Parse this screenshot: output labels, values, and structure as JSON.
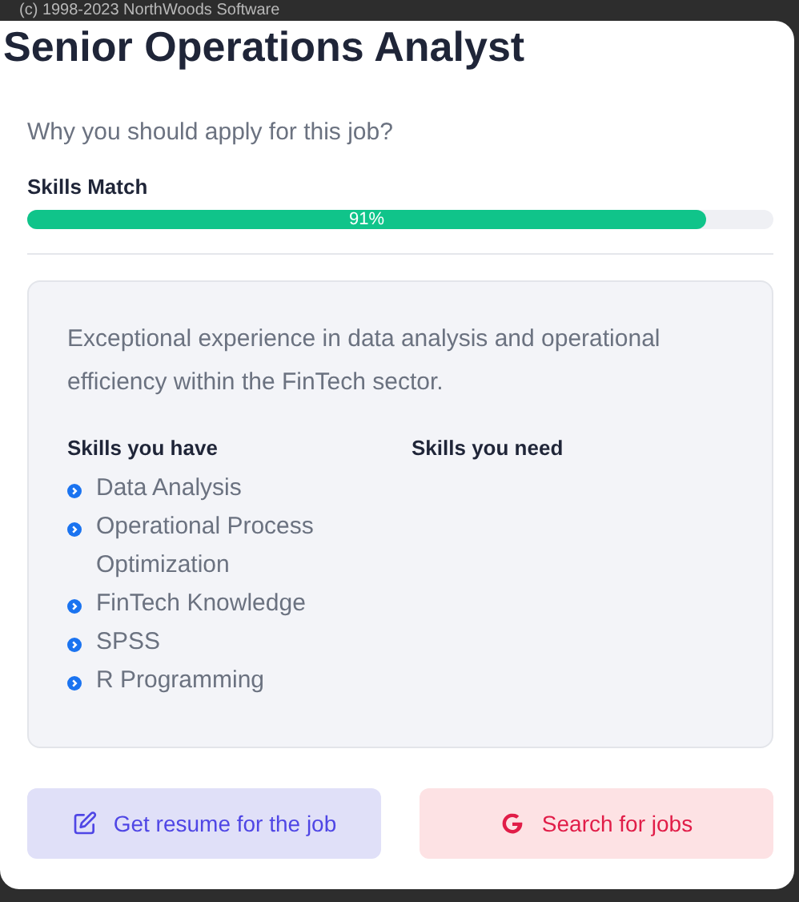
{
  "backdrop": {
    "copyright": "(c) 1998-2023 NorthWoods Software"
  },
  "dialog": {
    "title": "Senior Operations Analyst",
    "subtitle": "Why you should apply for this job?",
    "skills_match": {
      "label": "Skills Match",
      "level": 0.91,
      "reading": "91%"
    },
    "summary": "Exceptional experience in data analysis and operational efficiency within the FinTech sector.",
    "skills_have": {
      "heading": "Skills you have",
      "items": [
        "Data Analysis",
        "Operational Process Optimization",
        "FinTech Knowledge",
        "SPSS",
        "R Programming"
      ]
    },
    "skills_need": {
      "heading": "Skills you need"
    },
    "buttons": [
      {
        "kind": "resume",
        "label": "Get resume for the job"
      },
      {
        "kind": "search",
        "label": "Search for jobs"
      }
    ]
  }
}
